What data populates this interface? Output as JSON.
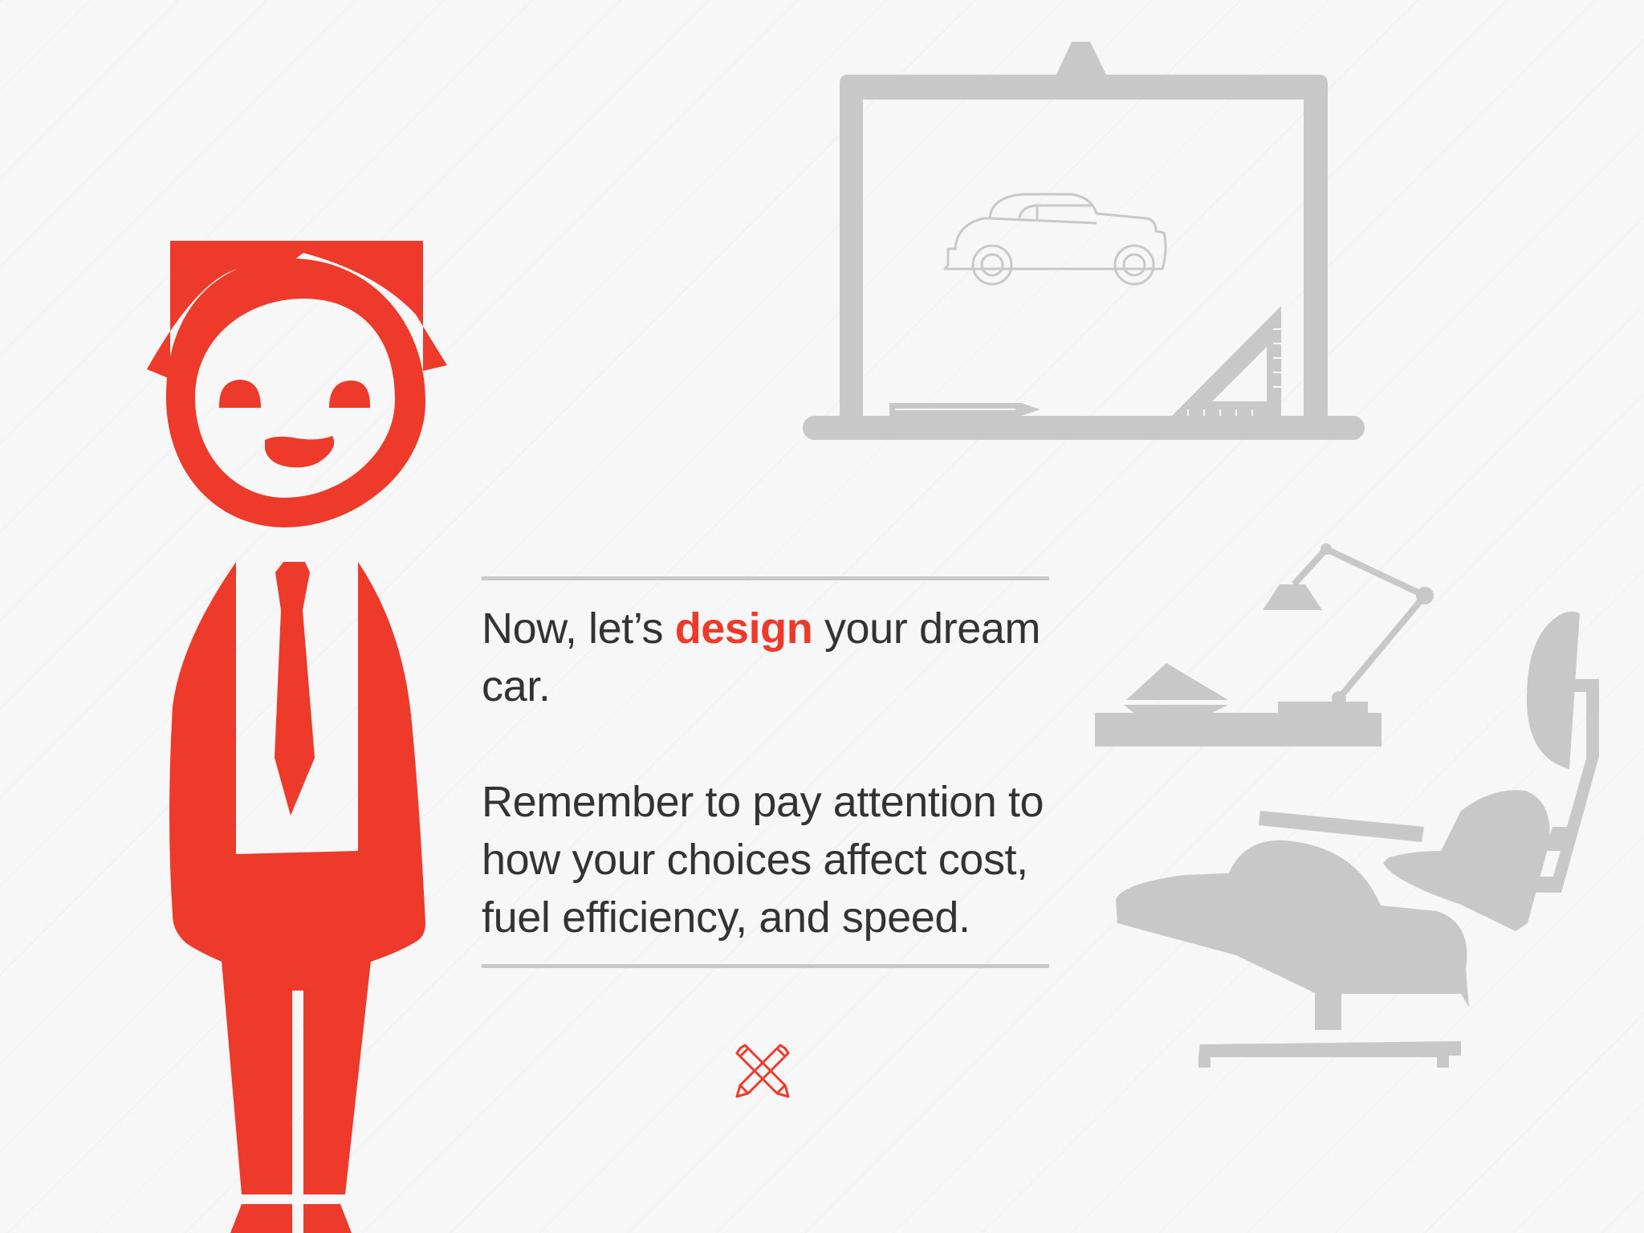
{
  "intro": {
    "line_before": "Now, let’s ",
    "highlight": "design",
    "line_after": " your dream car.",
    "reminder": "Remember to pay attention to how your choices affect cost, fuel efficiency, and speed."
  },
  "start_button": {
    "icon": "crossed-pencils-icon"
  },
  "colors": {
    "accent": "#ee3a2b",
    "text": "#333333",
    "illustration_gray": "#c8c8c8",
    "background": "#f7f7f7"
  }
}
